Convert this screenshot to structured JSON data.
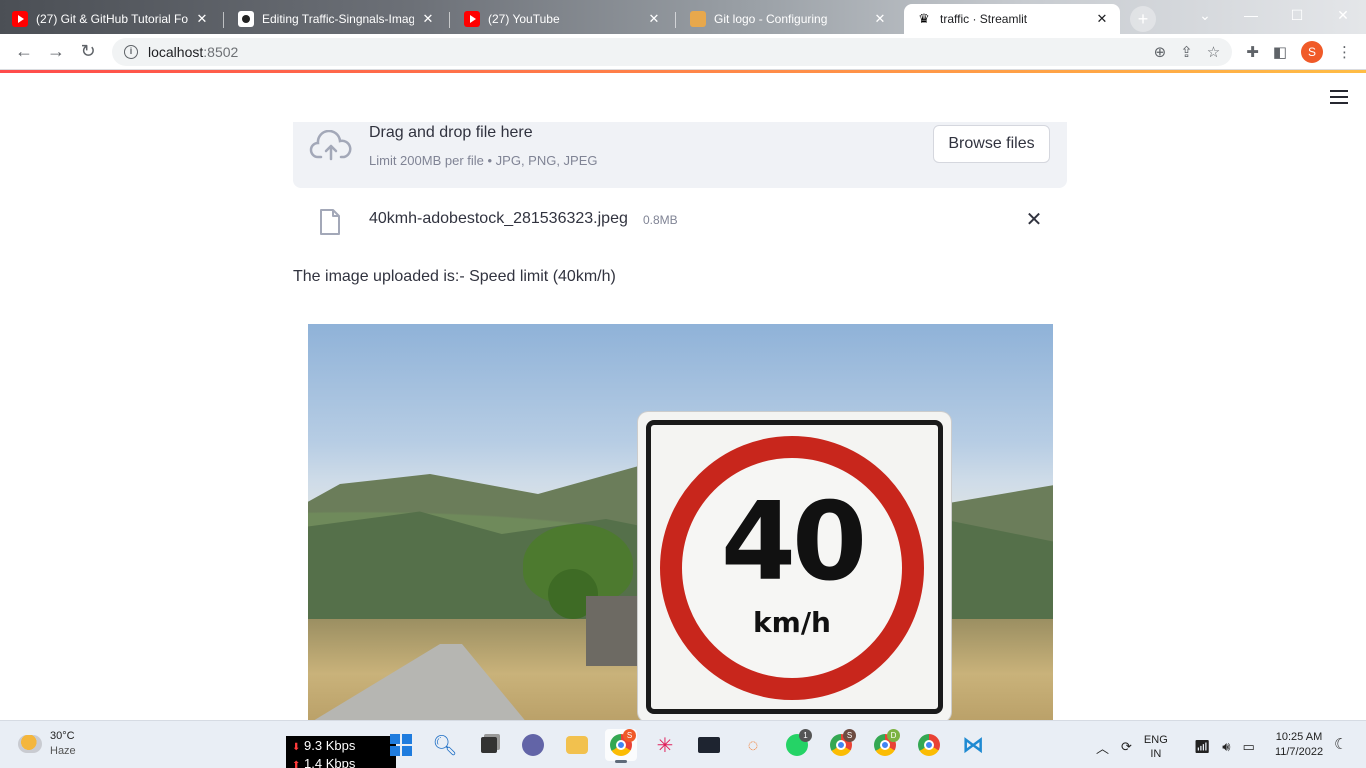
{
  "browser": {
    "tabs": [
      {
        "title": "(27) Git & GitHub Tutorial For",
        "favicon": "youtube-icon",
        "active": false
      },
      {
        "title": "Editing Traffic-Singnals-Imag",
        "favicon": "github-icon",
        "active": false
      },
      {
        "title": "(27) YouTube",
        "favicon": "youtube-icon",
        "active": false
      },
      {
        "title": "Git logo - Configuring",
        "favicon": "git-icon",
        "active": false
      },
      {
        "title": "traffic · Streamlit",
        "favicon": "streamlit-icon",
        "active": true
      }
    ],
    "address": {
      "host": "localhost",
      "port": ":8502"
    },
    "profile_initial": "S",
    "accent": "#ff4b4b"
  },
  "app": {
    "uploader": {
      "main_text": "Drag and drop file here",
      "limit_text": "Limit 200MB per file • JPG, PNG, JPEG",
      "browse_label": "Browse files"
    },
    "uploaded_file": {
      "name": "40kmh-adobestock_281536323.jpeg",
      "size": "0.8MB"
    },
    "result_text": "The image uploaded is:- Speed limit (40km/h)",
    "image": {
      "sign_number": "40",
      "sign_unit": "km/h"
    }
  },
  "taskbar": {
    "weather": {
      "temp": "30°C",
      "condition": "Haze"
    },
    "network": {
      "down": "9.3 Kbps",
      "up": "1.4 Kbps"
    },
    "tray": {
      "lang1": "ENG",
      "lang2": "IN"
    },
    "clock": {
      "time": "10:25 AM",
      "date": "11/7/2022"
    },
    "badges": {
      "whatsapp": "1",
      "chrome_s": "S",
      "chrome_d": "D"
    }
  }
}
